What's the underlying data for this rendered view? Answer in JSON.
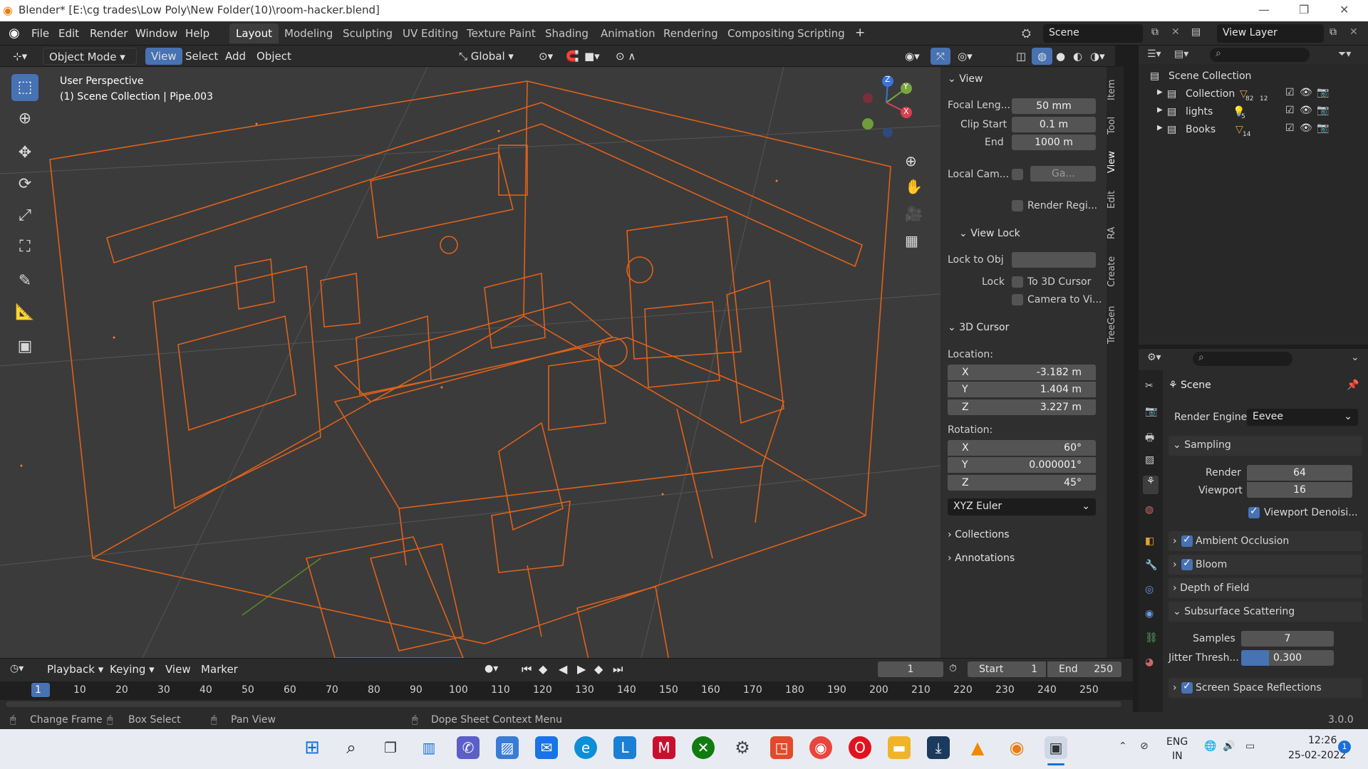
{
  "window": {
    "title": "Blender* [E:\\cg trades\\Low Poly\\New Folder(10)\\room-hacker.blend]",
    "controls": [
      "—",
      "❐",
      "✕"
    ]
  },
  "menu": [
    "File",
    "Edit",
    "Render",
    "Window",
    "Help"
  ],
  "workspaces": [
    "Layout",
    "Modeling",
    "Sculpting",
    "UV Editing",
    "Texture Paint",
    "Shading",
    "Animation",
    "Rendering",
    "Compositing",
    "Scripting"
  ],
  "add_workspace": "+",
  "scene_name": "Scene",
  "view_layer": "View Layer",
  "viewport_header": {
    "mode": "Object Mode",
    "menus": [
      "View",
      "Select",
      "Add",
      "Object"
    ],
    "orientation": "Global"
  },
  "viewport": {
    "perspective": "User Perspective",
    "collection_info": "(1) Scene Collection | Pipe.003",
    "gizmo_axes": [
      "Z",
      "Y",
      "X"
    ]
  },
  "tools": [
    "select-box",
    "cursor",
    "move",
    "rotate",
    "scale",
    "transform",
    "annotate",
    "measure",
    "add-cube"
  ],
  "npanel": {
    "view_header": "View",
    "focal_length_label": "Focal Leng...",
    "focal_length": "50 mm",
    "clip_start_label": "Clip Start",
    "clip_start": "0.1 m",
    "clip_end_label": "End",
    "clip_end": "1000 m",
    "local_camera_label": "Local Cam...",
    "local_camera_value": "Ga...",
    "render_region_label": "Render Regi...",
    "view_lock_header": "View Lock",
    "lock_to_obj_label": "Lock to Obj",
    "lock_label": "Lock",
    "to_3d_cursor": "To 3D Cursor",
    "camera_to_view": "Camera to Vi...",
    "cursor_header": "3D Cursor",
    "location_label": "Location:",
    "location": [
      {
        "axis": "X",
        "value": "-3.182 m"
      },
      {
        "axis": "Y",
        "value": "1.404 m"
      },
      {
        "axis": "Z",
        "value": "3.227 m"
      }
    ],
    "rotation_label": "Rotation:",
    "rotation": [
      {
        "axis": "X",
        "value": "60°"
      },
      {
        "axis": "Y",
        "value": "0.000001°"
      },
      {
        "axis": "Z",
        "value": "45°"
      }
    ],
    "rotation_mode": "XYZ Euler",
    "collections_header": "Collections",
    "annotations_header": "Annotations"
  },
  "side_tabs": [
    "Item",
    "Tool",
    "View",
    "Edit",
    "RA",
    "Create",
    "TreeGen"
  ],
  "outliner": {
    "root": "Scene Collection",
    "items": [
      {
        "name": "Collection",
        "badge1": "82",
        "badge2": "12"
      },
      {
        "name": "lights",
        "badge1": "5"
      },
      {
        "name": "Books",
        "badge1": "14"
      }
    ]
  },
  "properties": {
    "context": "Scene",
    "render_engine_label": "Render Engine",
    "render_engine": "Eevee",
    "sampling_header": "Sampling",
    "render_label": "Render",
    "render_samples": "64",
    "viewport_label": "Viewport",
    "viewport_samples": "16",
    "viewport_denoise": "Viewport Denoisi...",
    "ambient_occlusion": "Ambient Occlusion",
    "bloom": "Bloom",
    "depth_of_field": "Depth of Field",
    "subsurface_header": "Subsurface Scattering",
    "samples_label": "Samples",
    "samples": "7",
    "jitter_label": "Jitter Thresh...",
    "jitter": "0.300",
    "jitter_fraction": 0.3,
    "ssr": "Screen Space Reflections"
  },
  "timeline": {
    "menus": [
      "Playback",
      "Keying",
      "View",
      "Marker"
    ],
    "current_frame": "1",
    "start_label": "Start",
    "start": "1",
    "end_label": "End",
    "end": "250",
    "ruler": [
      "1",
      "10",
      "20",
      "30",
      "40",
      "50",
      "60",
      "70",
      "80",
      "90",
      "100",
      "110",
      "120",
      "130",
      "140",
      "150",
      "160",
      "170",
      "180",
      "190",
      "200",
      "210",
      "220",
      "230",
      "240",
      "250"
    ]
  },
  "statusbar": {
    "change_frame": "Change Frame",
    "box_select": "Box Select",
    "pan_view": "Pan View",
    "context_menu": "Dope Sheet Context Menu",
    "version": "3.0.0"
  },
  "taskbar": {
    "lang1": "ENG",
    "lang2": "IN",
    "time": "12:26",
    "date": "25-02-2022",
    "notifications": "1"
  },
  "colors": {
    "accent": "#4772b3",
    "wire": "#e0611a",
    "viewport_bg": "#3b3b3b"
  }
}
